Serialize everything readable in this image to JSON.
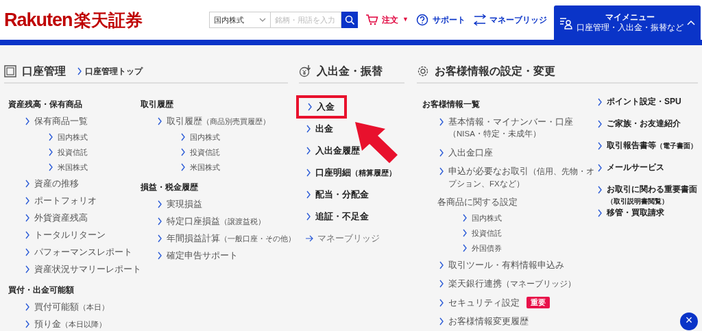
{
  "header": {
    "logo": {
      "brand": "Rakuten",
      "name": "楽天証券"
    },
    "search": {
      "category": "国内株式",
      "placeholder": "銘柄・用語を入力"
    },
    "nav": [
      {
        "kind": "cart",
        "label": "注文",
        "caret": "▼"
      },
      {
        "kind": "support",
        "label": "サポート"
      },
      {
        "kind": "bank",
        "label": "マネーブリッジ"
      }
    ],
    "my_menu": {
      "title": "マイメニュー",
      "subtitle": "口座管理・入出金・振替など",
      "expanded": true
    }
  },
  "account": {
    "title": "口座管理",
    "top_link": "口座管理トップ",
    "columns": [
      [
        {
          "heading": "資産残高・保有商品",
          "items": [
            {
              "label": "保有商品一覧",
              "children": [
                {
                  "label": "国内株式"
                },
                {
                  "label": "投資信託"
                },
                {
                  "label": "米国株式"
                }
              ]
            },
            {
              "label": "資産の推移"
            },
            {
              "label": "ポートフォリオ"
            },
            {
              "label": "外貨資産残高"
            },
            {
              "label": "トータルリターン"
            },
            {
              "label": "パフォーマンスレポート"
            },
            {
              "label": "資産状況サマリーレポート"
            }
          ]
        },
        {
          "heading": "買付・出金可能額",
          "items": [
            {
              "label": "買付可能額",
              "note": "（本日）"
            },
            {
              "label": "預り金",
              "note": "（本日以降）"
            }
          ]
        }
      ],
      [
        {
          "heading": "取引履歴",
          "items": [
            {
              "label": "取引履歴",
              "note": "（商品別売買履歴）",
              "children": [
                {
                  "label": "国内株式"
                },
                {
                  "label": "投資信託"
                },
                {
                  "label": "米国株式"
                }
              ]
            }
          ]
        },
        {
          "heading": "損益・税金履歴",
          "items": [
            {
              "label": "実現損益"
            },
            {
              "label": "特定口座損益",
              "note": "（譲渡益税）"
            },
            {
              "label": "年間損益計算",
              "note": "（一般口座・その他）"
            },
            {
              "label": "確定申告サポート"
            }
          ]
        }
      ]
    ]
  },
  "transfer": {
    "title": "入出金・振替",
    "items": [
      {
        "kind": "link",
        "label": "入金",
        "highlighted": true
      },
      {
        "kind": "link",
        "label": "出金"
      },
      {
        "kind": "link",
        "label": "入出金履歴"
      },
      {
        "kind": "link",
        "label": "口座明細",
        "note": "（精算履歴）"
      },
      {
        "kind": "link",
        "label": "配当・分配金"
      },
      {
        "kind": "link",
        "label": "追証・不足金"
      },
      {
        "kind": "external",
        "label": "マネーブリッジ"
      }
    ]
  },
  "customer": {
    "title": "お客様情報の設定・変更",
    "heading": "お客様情報一覧",
    "items": [
      {
        "kind": "link",
        "label": "基本情報・マイナンバー・口座",
        "note": "（NISA・特定・未成年）"
      },
      {
        "kind": "link",
        "label": "入出金口座"
      },
      {
        "kind": "link",
        "label": "申込が必要なお取引",
        "note": "（信用、先物・オプション、FXなど）"
      },
      {
        "kind": "group",
        "label": "各商品に関する設定",
        "children": [
          {
            "label": "国内株式"
          },
          {
            "label": "投資信託"
          },
          {
            "label": "外国債券"
          }
        ]
      },
      {
        "kind": "link",
        "label": "取引ツール・有料情報申込み"
      },
      {
        "kind": "link",
        "label": "楽天銀行連携",
        "note": "（マネーブリッジ）"
      },
      {
        "kind": "link",
        "label": "セキュリティ設定",
        "badge": "重要"
      },
      {
        "kind": "link",
        "label": "お客様情報変更履歴"
      }
    ],
    "links": [
      {
        "label": "ポイント設定・SPU"
      },
      {
        "label": "ご家族・お友達紹介"
      },
      {
        "label": "取引報告書等",
        "note": "（電子書面）"
      },
      {
        "label": "メールサービス"
      },
      {
        "label": "お取引に関わる重要書面",
        "note": "（取引説明書閲覧）"
      },
      {
        "label": "移管・買取請求"
      }
    ]
  },
  "close_button": "×"
}
